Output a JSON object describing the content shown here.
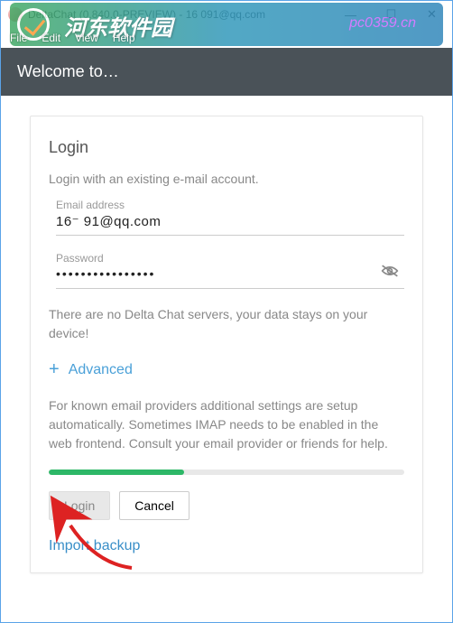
{
  "titlebar": {
    "text": "DeltaChat (0.840.0-PREVIEW) - 16        091@qq.com"
  },
  "menubar": {
    "items": [
      "File",
      "Edit",
      "View",
      "Help"
    ]
  },
  "watermark": {
    "main": "河东软件园",
    "sub": "pc0359.cn"
  },
  "header": {
    "title": "Welcome to…"
  },
  "login": {
    "heading": "Login",
    "subtitle": "Login with an existing e-mail account.",
    "email_label": "Email address",
    "email_value": "16⁻        91@qq.com",
    "password_label": "Password",
    "password_value": "••••••••••••••••",
    "info1": "There are no Delta Chat servers, your data stays on your device!",
    "advanced": "Advanced",
    "info2": "For known email providers additional settings are setup automatically. Sometimes IMAP needs to be enabled in the web frontend. Consult your email provider or friends for help.",
    "login_btn": "Login",
    "cancel_btn": "Cancel",
    "import_link": "Import backup"
  }
}
